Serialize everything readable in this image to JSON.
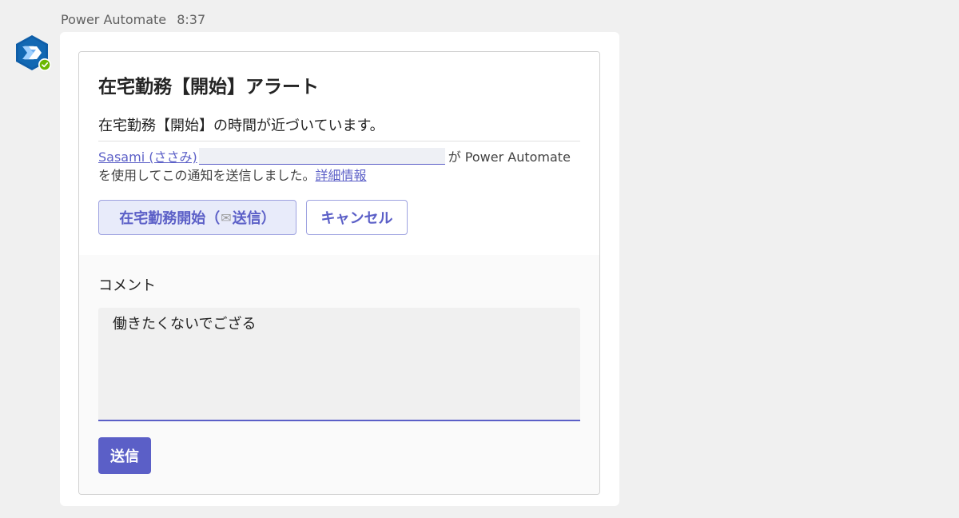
{
  "message": {
    "sender": "Power Automate",
    "time": "8:37"
  },
  "card": {
    "title": "在宅勤務【開始】アラート",
    "subtitle": "在宅勤務【開始】の時間が近づいています。",
    "notice": {
      "user_link": "Sasami (ささみ)",
      "text_before_app": "が Power Automate",
      "text_after": "を使用してこの通知を送信しました。",
      "more_info_link": "詳細情報"
    },
    "actions": {
      "start_prefix": "在宅勤務開始（",
      "start_icon": "envelope-icon",
      "start_suffix": "送信）",
      "cancel_label": "キャンセル"
    },
    "comment": {
      "label": "コメント",
      "value": "働きたくないでござる"
    },
    "send_label": "送信"
  },
  "colors": {
    "accent": "#5b5fc7",
    "accent_light": "#e8ebfa",
    "status_available": "#6bb700",
    "avatar_bg": "#0f6cbd"
  }
}
